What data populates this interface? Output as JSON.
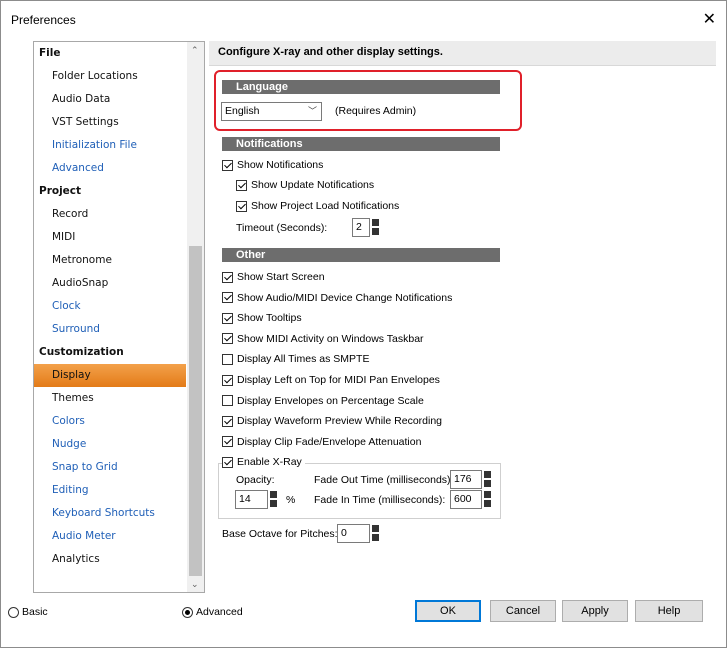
{
  "window": {
    "title": "Preferences",
    "close": "✕"
  },
  "sidebar": {
    "items": [
      {
        "label": "File",
        "type": "cat"
      },
      {
        "label": "Folder Locations",
        "type": "item"
      },
      {
        "label": "Audio Data",
        "type": "item"
      },
      {
        "label": "VST Settings",
        "type": "item"
      },
      {
        "label": "Initialization File",
        "type": "link"
      },
      {
        "label": "Advanced",
        "type": "link"
      },
      {
        "label": "Project",
        "type": "cat"
      },
      {
        "label": "Record",
        "type": "item"
      },
      {
        "label": "MIDI",
        "type": "item"
      },
      {
        "label": "Metronome",
        "type": "item"
      },
      {
        "label": "AudioSnap",
        "type": "item"
      },
      {
        "label": "Clock",
        "type": "link"
      },
      {
        "label": "Surround",
        "type": "link"
      },
      {
        "label": "Customization",
        "type": "cat"
      },
      {
        "label": "Display",
        "type": "selected"
      },
      {
        "label": "Themes",
        "type": "item"
      },
      {
        "label": "Colors",
        "type": "link"
      },
      {
        "label": "Nudge",
        "type": "link"
      },
      {
        "label": "Snap to Grid",
        "type": "link"
      },
      {
        "label": "Editing",
        "type": "link"
      },
      {
        "label": "Keyboard Shortcuts",
        "type": "link"
      },
      {
        "label": "Audio Meter",
        "type": "link"
      },
      {
        "label": "Analytics",
        "type": "item"
      }
    ]
  },
  "panel": {
    "header": "Configure X-ray and other display settings.",
    "language": {
      "section": "Language",
      "selected": "English",
      "note": "(Requires Admin)"
    },
    "notifications": {
      "section": "Notifications",
      "show": "Show Notifications",
      "update": "Show Update Notifications",
      "project_load": "Show Project Load Notifications",
      "timeout_label": "Timeout (Seconds):",
      "timeout_value": "2"
    },
    "other": {
      "section": "Other",
      "options": [
        {
          "label": "Show Start Screen",
          "checked": true
        },
        {
          "label": "Show Audio/MIDI Device Change Notifications",
          "checked": true
        },
        {
          "label": "Show Tooltips",
          "checked": true
        },
        {
          "label": "Show MIDI Activity on Windows Taskbar",
          "checked": true
        },
        {
          "label": "Display All Times as SMPTE",
          "checked": false
        },
        {
          "label": "Display Left on Top for MIDI Pan Envelopes",
          "checked": true
        },
        {
          "label": "Display Envelopes on Percentage Scale",
          "checked": false
        },
        {
          "label": "Display Waveform Preview While Recording",
          "checked": true
        },
        {
          "label": "Display Clip Fade/Envelope Attenuation",
          "checked": true
        }
      ],
      "xray": {
        "enable": "Enable X-Ray",
        "opacity_label": "Opacity:",
        "opacity_value": "14",
        "percent": "%",
        "fade_out_label": "Fade Out Time (milliseconds):",
        "fade_out_value": "176",
        "fade_in_label": "Fade In Time (milliseconds):",
        "fade_in_value": "600"
      },
      "base_octave_label": "Base Octave for Pitches:",
      "base_octave_value": "0"
    }
  },
  "footer": {
    "basic": "Basic",
    "advanced": "Advanced",
    "ok": "OK",
    "cancel": "Cancel",
    "apply": "Apply",
    "help": "Help"
  },
  "colors": {
    "highlight": "#e0202a",
    "selected": "#e37b18",
    "link": "#1f5fb7"
  }
}
